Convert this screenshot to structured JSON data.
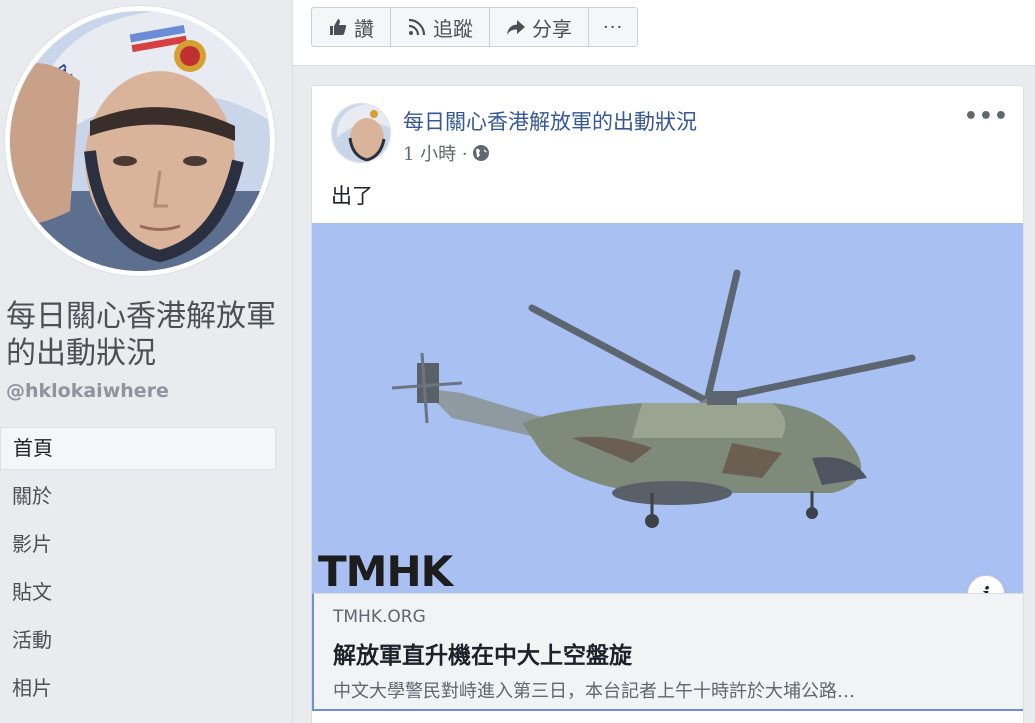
{
  "sidebar": {
    "page_name": "每日關心香港解放軍的出動狀況",
    "handle": "@hklokaiwhere",
    "nav": [
      {
        "label": "首頁",
        "active": true
      },
      {
        "label": "關於"
      },
      {
        "label": "影片"
      },
      {
        "label": "貼文"
      },
      {
        "label": "活動"
      },
      {
        "label": "相片"
      }
    ]
  },
  "action_bar": {
    "like_label": "讚",
    "follow_label": "追蹤",
    "share_label": "分享",
    "more_label": "···"
  },
  "post": {
    "author": "每日關心香港解放軍的出動狀況",
    "time": "1 小時 ·",
    "menu": "•••",
    "text": "出了",
    "image_watermark": "TMHK",
    "info_label": "i",
    "link": {
      "domain": "TMHK.ORG",
      "title": "解放軍直升機在中大上空盤旋",
      "description": "中文大學警民對峙進入第三日，本台記者上午十時許於大埔公路…"
    }
  },
  "colors": {
    "link_blue": "#365899",
    "sky": "#a9c1f2",
    "background": "#e9ebee"
  }
}
